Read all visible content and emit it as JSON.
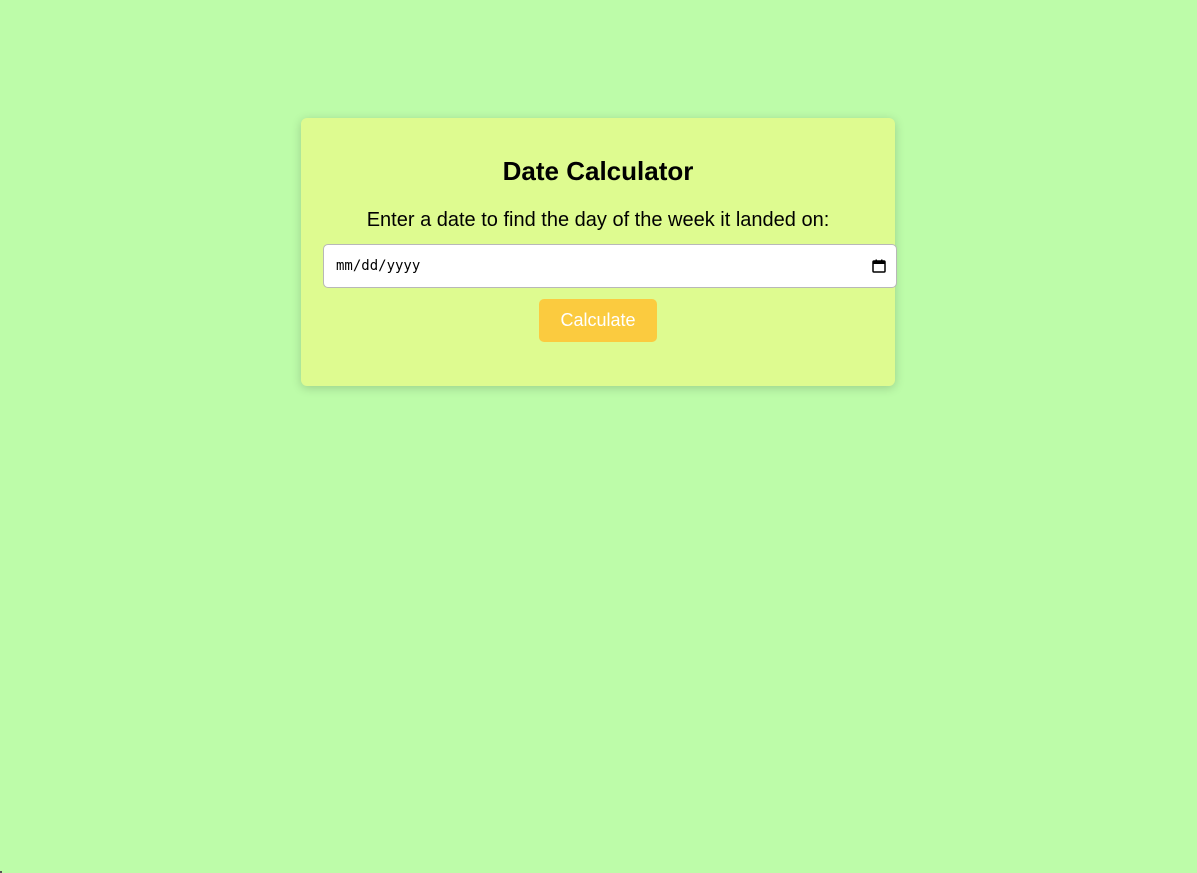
{
  "page": {
    "background_color": "#bdfca9"
  },
  "card": {
    "background_color": "#defb90",
    "title": "Date Calculator",
    "prompt": "Enter a date to find the day of the week it landed on:",
    "date_input": {
      "placeholder": "mm/dd/yyyy",
      "value": "",
      "icon": "calendar-icon"
    },
    "calculate_button": {
      "label": "Calculate",
      "color": "#fbcb3f",
      "text_color": "#ffffff"
    }
  }
}
